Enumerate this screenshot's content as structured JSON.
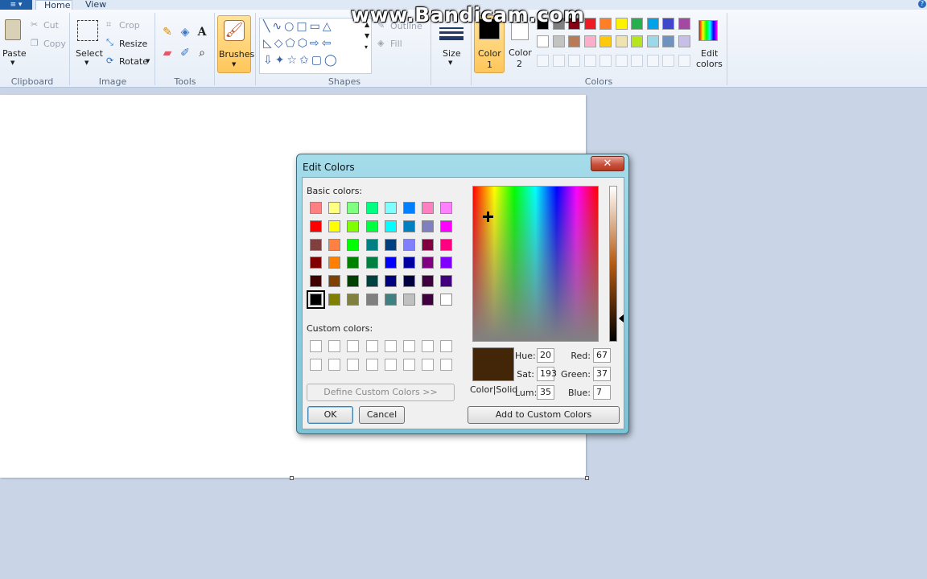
{
  "watermark": "www.Bandicam.com",
  "tabs": {
    "home": "Home",
    "view": "View"
  },
  "clipboard": {
    "paste": "Paste",
    "cut": "Cut",
    "copy": "Copy",
    "label": "Clipboard"
  },
  "image": {
    "select": "Select",
    "crop": "Crop",
    "resize": "Resize",
    "rotate": "Rotate",
    "label": "Image"
  },
  "tools": {
    "label": "Tools"
  },
  "brushes": {
    "label": "Brushes"
  },
  "shapes": {
    "label": "Shapes",
    "outline": "Outline",
    "fill": "Fill"
  },
  "size": {
    "label": "Size"
  },
  "colors": {
    "color1": "Color",
    "color1_num": "1",
    "color2": "Color",
    "color2_num": "2",
    "label": "Colors",
    "edit": "Edit",
    "edit2": "colors",
    "palette": [
      "#000000",
      "#7f7f7f",
      "#880015",
      "#ed1c24",
      "#ff7f27",
      "#fff200",
      "#22b14c",
      "#00a2e8",
      "#3f48cc",
      "#a349a4",
      "#ffffff",
      "#c3c3c3",
      "#b97a57",
      "#ffaec9",
      "#ffc90e",
      "#efe4b0",
      "#b5e61d",
      "#99d9ea",
      "#7092be",
      "#c8bfe7"
    ]
  },
  "dialog": {
    "title": "Edit Colors",
    "close": "✕",
    "basic_label": "Basic colors:",
    "custom_label": "Custom colors:",
    "basic_colors": [
      "#ff8080",
      "#ffff80",
      "#80ff80",
      "#00ff80",
      "#80ffff",
      "#0080ff",
      "#ff80c0",
      "#ff80ff",
      "#ff0000",
      "#ffff00",
      "#80ff00",
      "#00ff40",
      "#00ffff",
      "#0080c0",
      "#8080c0",
      "#ff00ff",
      "#804040",
      "#ff8040",
      "#00ff00",
      "#008080",
      "#004080",
      "#8080ff",
      "#800040",
      "#ff0080",
      "#800000",
      "#ff8000",
      "#008000",
      "#008040",
      "#0000ff",
      "#0000a0",
      "#800080",
      "#8000ff",
      "#400000",
      "#804000",
      "#004000",
      "#004040",
      "#000080",
      "#000040",
      "#400040",
      "#400080",
      "#000000",
      "#808000",
      "#808040",
      "#808080",
      "#408080",
      "#c0c0c0",
      "#400040",
      "#ffffff"
    ],
    "define_custom": "Define Custom Colors >>",
    "ok": "OK",
    "cancel": "Cancel",
    "add_custom": "Add to Custom Colors",
    "color_solid": "Color|Solid",
    "hue_label": "Hue:",
    "hue": "20",
    "sat_label": "Sat:",
    "sat": "193",
    "lum_label": "Lum:",
    "lum": "35",
    "red_label": "Red:",
    "red": "67",
    "green_label": "Green:",
    "green": "37",
    "blue_label": "Blue:",
    "blue": "7"
  }
}
